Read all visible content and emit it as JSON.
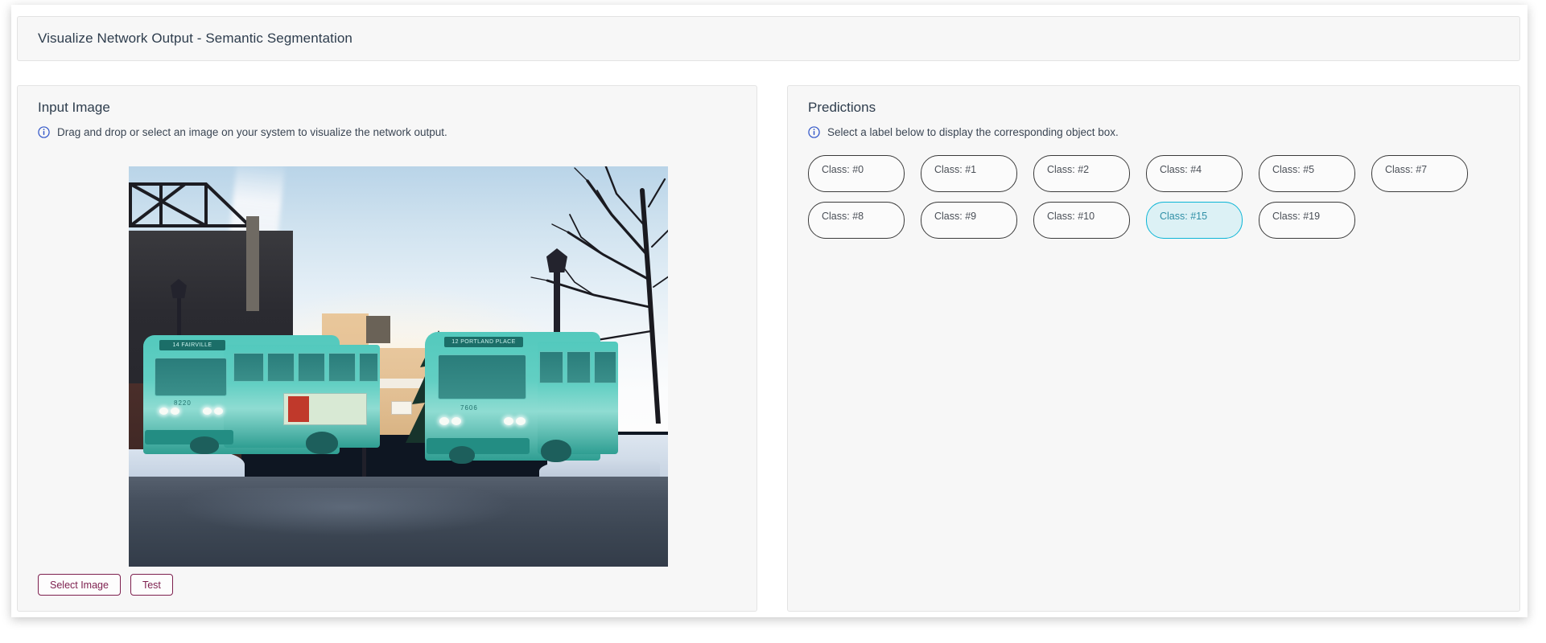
{
  "header": {
    "title": "Visualize Network Output - Semantic Segmentation"
  },
  "left_panel": {
    "title": "Input Image",
    "hint": "Drag and drop or select an image on your system to visualize the network output.",
    "info_icon": "info-circle-icon",
    "image": {
      "alt": "Two transit buses highlighted with teal semantic-segmentation overlay on a snowy winter street",
      "bus_signs": [
        "14  FAIRVILLE",
        "12  PORTLAND PLACE"
      ],
      "bus_numbers": [
        "8220",
        "7606"
      ]
    },
    "buttons": [
      {
        "label": "Select Image",
        "name": "select-image-button"
      },
      {
        "label": "Test",
        "name": "test-button"
      }
    ]
  },
  "right_panel": {
    "title": "Predictions",
    "hint": "Select a label below to display the corresponding object box.",
    "info_icon": "info-circle-icon",
    "chip_rows": [
      [
        {
          "label": "Class: #0",
          "selected": false
        },
        {
          "label": "Class: #1",
          "selected": false
        },
        {
          "label": "Class: #2",
          "selected": false
        },
        {
          "label": "Class: #4",
          "selected": false
        },
        {
          "label": "Class: #5",
          "selected": false
        },
        {
          "label": "Class: #7",
          "selected": false
        }
      ],
      [
        {
          "label": "Class: #8",
          "selected": false
        },
        {
          "label": "Class: #9",
          "selected": false
        },
        {
          "label": "Class: #10",
          "selected": false
        },
        {
          "label": "Class: #15",
          "selected": true
        },
        {
          "label": "Class: #19",
          "selected": false
        }
      ]
    ]
  },
  "colors": {
    "accent_button": "#7d1f4e",
    "selected_chip_border": "#0cb5d6",
    "selected_chip_fill": "#dcf1f5",
    "selected_chip_text": "#2f8fa6",
    "info_icon": "#2f54c8",
    "panel_bg": "#f7f7f7",
    "panel_border": "#e3e3e3",
    "title_text": "#2e3d4d",
    "segmentation_overlay": "#53c9bd"
  }
}
